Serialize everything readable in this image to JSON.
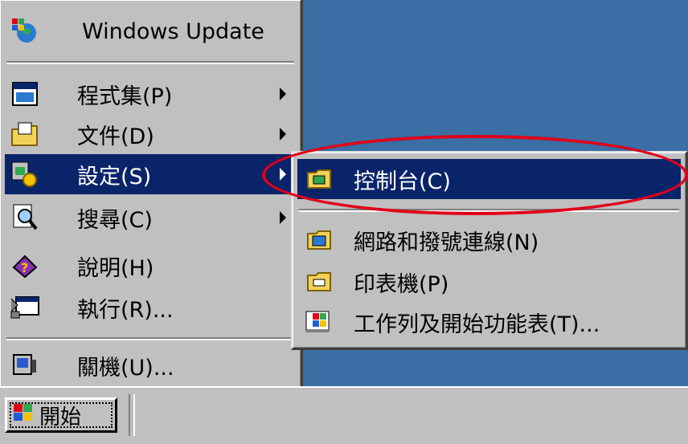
{
  "start_menu": {
    "items": [
      {
        "label": "Windows Update",
        "icon": "windows-update-icon",
        "has_submenu": false
      },
      {
        "label": "程式集(P)",
        "icon": "programs-icon",
        "has_submenu": true
      },
      {
        "label": "文件(D)",
        "icon": "documents-icon",
        "has_submenu": true
      },
      {
        "label": "設定(S)",
        "icon": "settings-icon",
        "has_submenu": true,
        "active": true
      },
      {
        "label": "搜尋(C)",
        "icon": "search-icon",
        "has_submenu": true
      },
      {
        "label": "說明(H)",
        "icon": "help-icon",
        "has_submenu": false
      },
      {
        "label": "執行(R)...",
        "icon": "run-icon",
        "has_submenu": false
      },
      {
        "label": "關機(U)...",
        "icon": "shutdown-icon",
        "has_submenu": false
      }
    ]
  },
  "settings_submenu": {
    "items": [
      {
        "label": "控制台(C)",
        "icon": "control-panel-icon",
        "active": true
      },
      {
        "label": "網路和撥號連線(N)",
        "icon": "network-icon"
      },
      {
        "label": "印表機(P)",
        "icon": "printer-icon"
      },
      {
        "label": "工作列及開始功能表(T)...",
        "icon": "taskbar-icon"
      }
    ]
  },
  "taskbar": {
    "start_label": "開始"
  },
  "colors": {
    "desktop": "#3a6ea5",
    "menu_bg": "#c0c0c0",
    "highlight": "#0a246a",
    "annotation": "#e0001a"
  }
}
